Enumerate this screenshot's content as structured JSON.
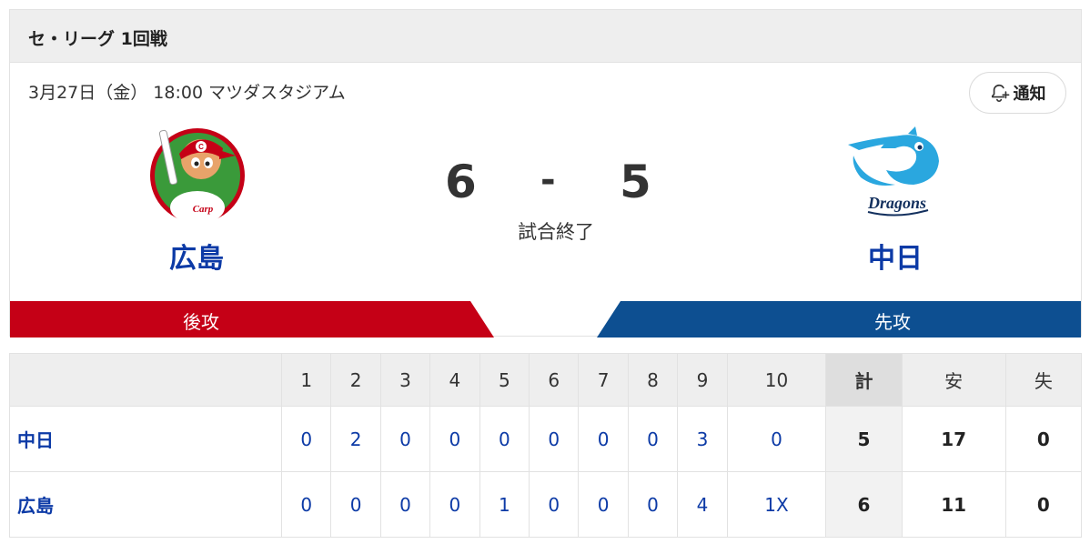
{
  "header": {
    "title": "セ・リーグ 1回戦"
  },
  "game": {
    "info": "3月27日（金） 18:00 マツダスタジアム",
    "notify_label": "通知",
    "status": "試合終了"
  },
  "home": {
    "name": "広島",
    "score": "6",
    "side": "後攻",
    "color": "#c50016",
    "logo_text": "Carp"
  },
  "away": {
    "name": "中日",
    "score": "5",
    "side": "先攻",
    "color": "#0d4f91",
    "logo_text": "Dragons"
  },
  "score_dash": "-",
  "scoreboard": {
    "headers": [
      "1",
      "2",
      "3",
      "4",
      "5",
      "6",
      "7",
      "8",
      "9",
      "10",
      "計",
      "安",
      "失"
    ],
    "rows": [
      {
        "team": "中日",
        "innings": [
          "0",
          "2",
          "0",
          "0",
          "0",
          "0",
          "0",
          "0",
          "3",
          "0"
        ],
        "total": "5",
        "hits": "17",
        "errors": "0"
      },
      {
        "team": "広島",
        "innings": [
          "0",
          "0",
          "0",
          "0",
          "1",
          "0",
          "0",
          "0",
          "4",
          "1X"
        ],
        "total": "6",
        "hits": "11",
        "errors": "0"
      }
    ]
  },
  "icons": {
    "notify": "bell-plus-icon",
    "home_logo": "carp-logo",
    "away_logo": "dragons-logo"
  }
}
